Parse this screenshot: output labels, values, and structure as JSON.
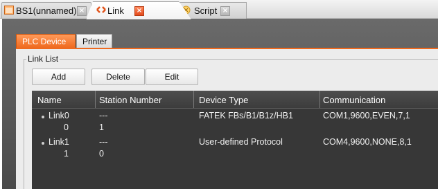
{
  "doc_tabs": [
    {
      "label": "BS1(unnamed)",
      "icon": "project-icon",
      "active": false
    },
    {
      "label": "Link",
      "icon": "link-icon",
      "active": true
    },
    {
      "label": "Script",
      "icon": "script-icon",
      "active": false
    }
  ],
  "inner_tabs": [
    {
      "label": "PLC Device",
      "active": true
    },
    {
      "label": "Printer",
      "active": false
    }
  ],
  "group": {
    "title": "Link List"
  },
  "buttons": {
    "add": "Add",
    "delete": "Delete",
    "edit": "Edit"
  },
  "columns": [
    "Name",
    "Station Number",
    "Device Type",
    "Communication"
  ],
  "links": [
    {
      "name": "Link0",
      "station": "---",
      "device": "FATEK FBs/B1/B1z/HB1",
      "comm": "COM1,9600,EVEN,7,1",
      "child": {
        "name": "0",
        "station": "1"
      }
    },
    {
      "name": "Link1",
      "station": "---",
      "device": "User-defined Protocol",
      "comm": "COM4,9600,NONE,8,1",
      "child": {
        "name": "1",
        "station": "0"
      }
    }
  ],
  "colors": {
    "accent": "#ef6a1f",
    "list_bg": "#373737",
    "panel_bg": "#ececec"
  }
}
